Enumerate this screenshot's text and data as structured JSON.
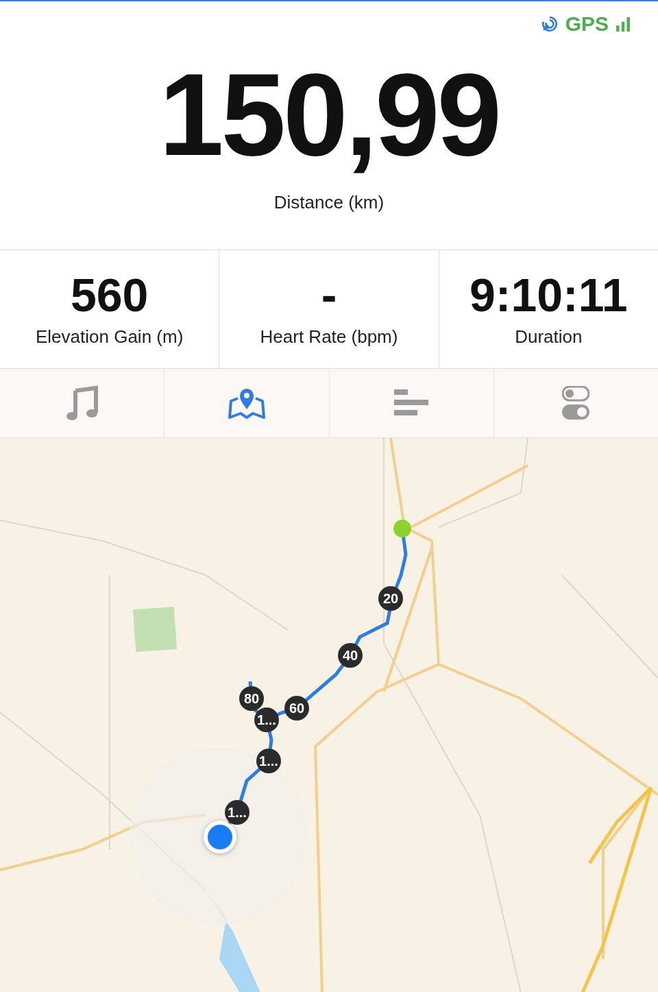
{
  "status": {
    "gps_label": "GPS"
  },
  "main_metric": {
    "value": "150,99",
    "label": "Distance (km)"
  },
  "metrics": [
    {
      "value": "560",
      "label": "Elevation Gain (m)"
    },
    {
      "value": "-",
      "label": "Heart Rate (bpm)"
    },
    {
      "value": "9:10:11",
      "label": "Duration"
    }
  ],
  "tabs": [
    {
      "kind": "music",
      "selected": false
    },
    {
      "kind": "map",
      "selected": true
    },
    {
      "kind": "splits",
      "selected": false
    },
    {
      "kind": "settings",
      "selected": false
    }
  ],
  "map": {
    "route_markers": [
      {
        "label": "20"
      },
      {
        "label": "40"
      },
      {
        "label": "60"
      },
      {
        "label": "80"
      },
      {
        "label": "1..."
      },
      {
        "label": "1..."
      },
      {
        "label": "1..."
      }
    ]
  }
}
